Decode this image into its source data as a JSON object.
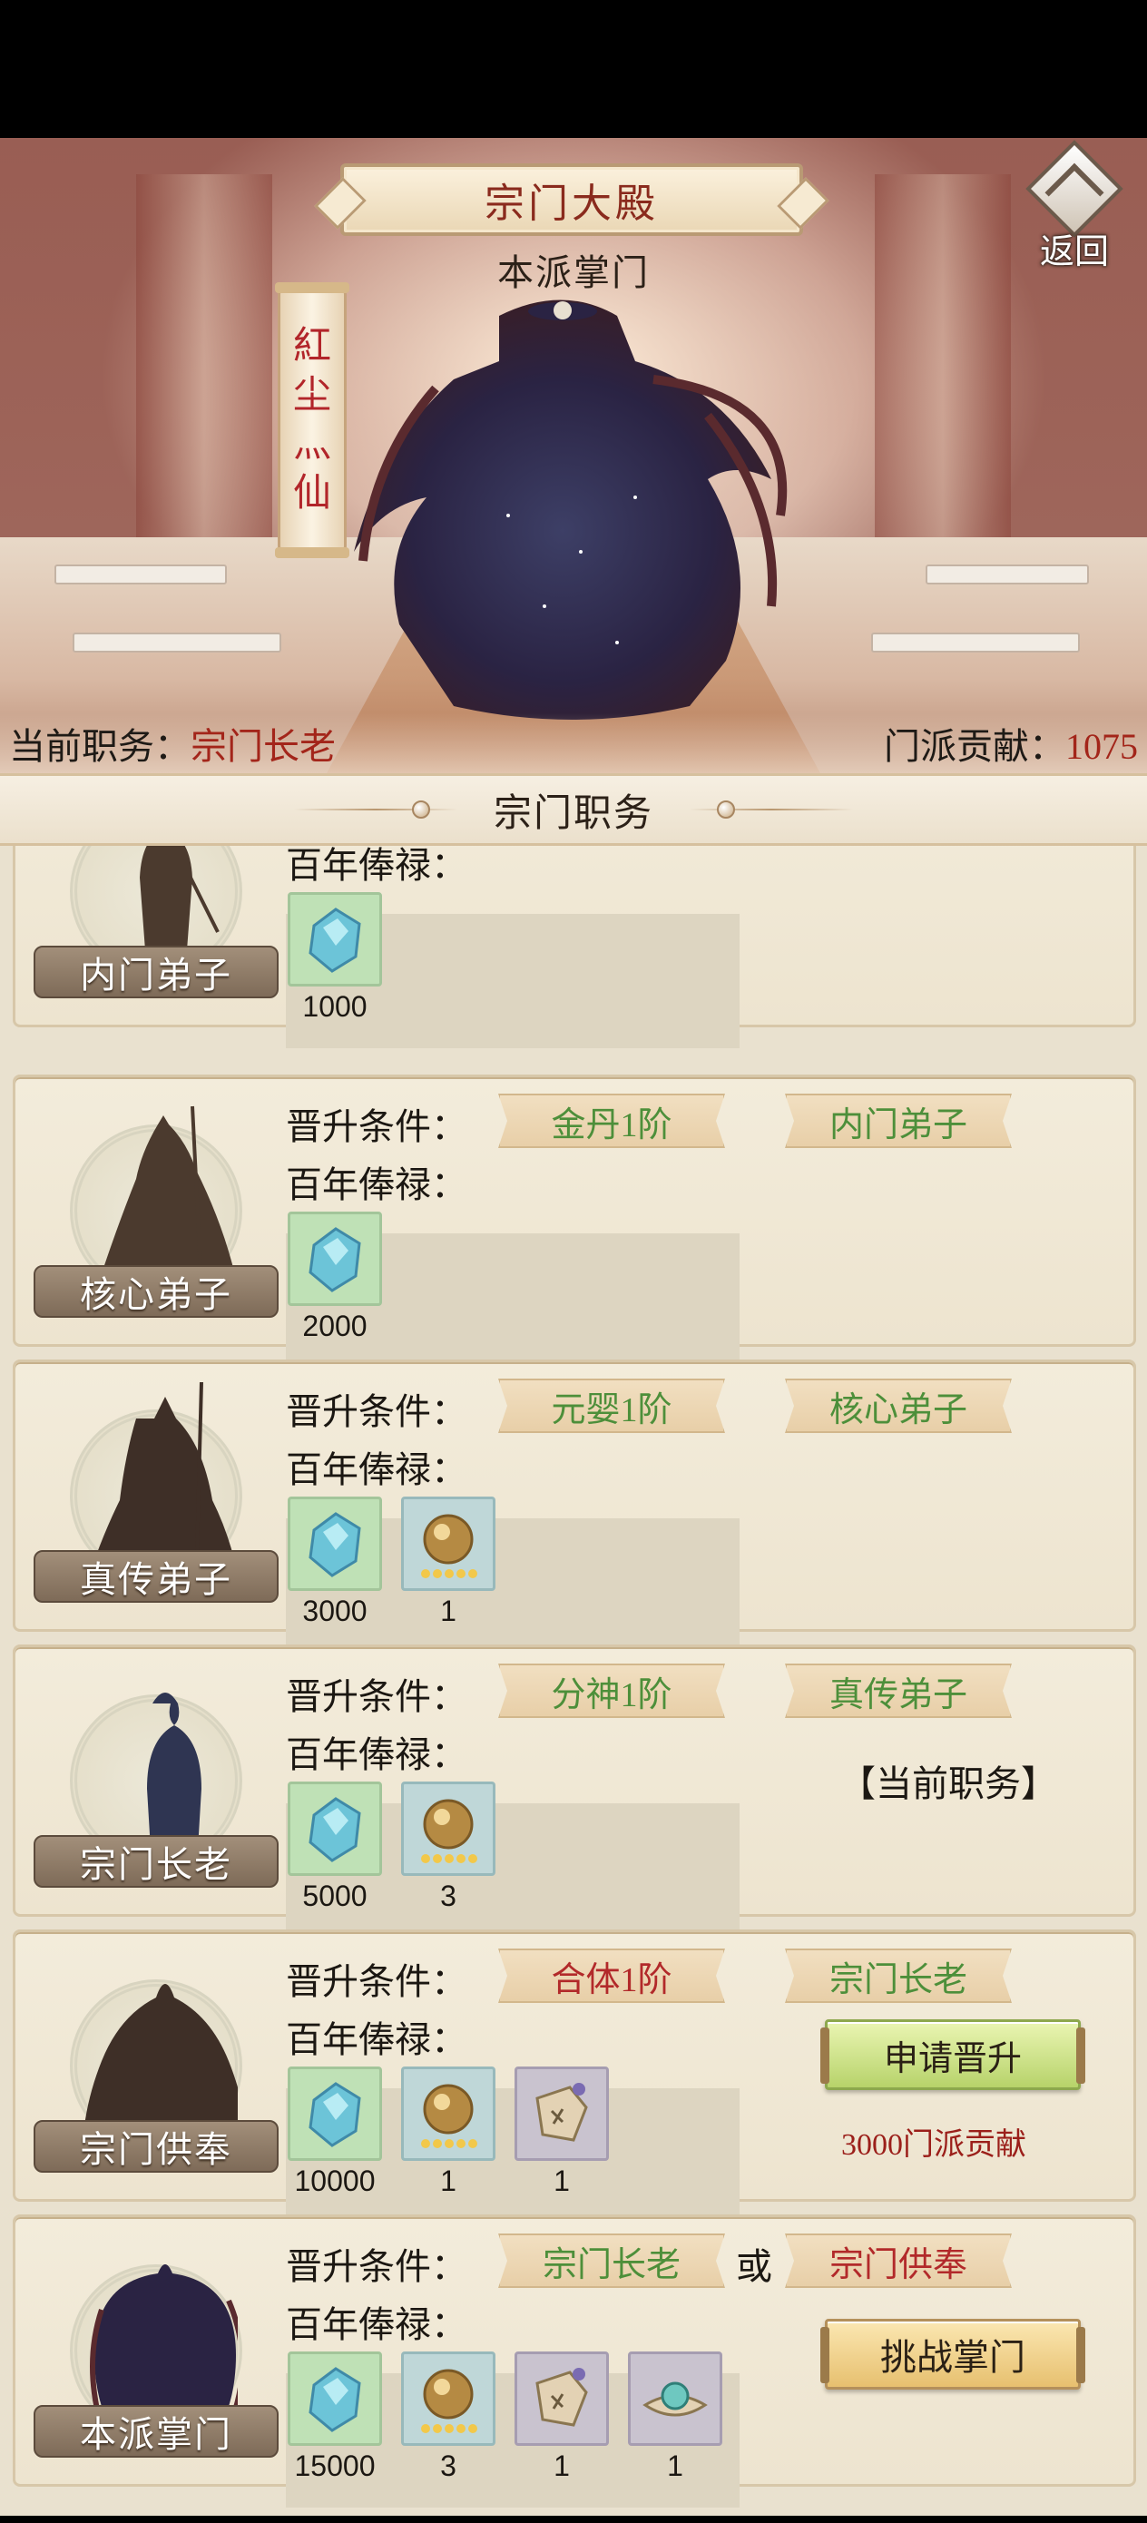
{
  "header": {
    "title": "宗门大殿",
    "leader_label": "本派掌门",
    "leader_name": [
      "紅",
      "尘",
      "灬",
      "仙"
    ],
    "back_label": "返回",
    "position_label": "当前职务：",
    "position_value": "宗门长老",
    "contribution_label": "门派贡献：",
    "contribution_value": "1075"
  },
  "section": {
    "title": "宗门职务"
  },
  "labels": {
    "promote_cond": "晋升条件：",
    "salary": "百年俸禄：",
    "or": "或"
  },
  "ranks": [
    {
      "name": "内门弟子",
      "conditions": [],
      "rewards": [
        {
          "type": "crystal",
          "qty": "1000"
        }
      ]
    },
    {
      "name": "核心弟子",
      "conditions": [
        {
          "text": "金丹1阶",
          "met": true
        },
        {
          "text": "内门弟子",
          "met": true
        }
      ],
      "rewards": [
        {
          "type": "crystal",
          "qty": "2000"
        }
      ]
    },
    {
      "name": "真传弟子",
      "conditions": [
        {
          "text": "元婴1阶",
          "met": true
        },
        {
          "text": "核心弟子",
          "met": true
        }
      ],
      "rewards": [
        {
          "type": "crystal",
          "qty": "3000"
        },
        {
          "type": "orb",
          "qty": "1"
        }
      ]
    },
    {
      "name": "宗门长老",
      "conditions": [
        {
          "text": "分神1阶",
          "met": true
        },
        {
          "text": "真传弟子",
          "met": true
        }
      ],
      "rewards": [
        {
          "type": "crystal",
          "qty": "5000"
        },
        {
          "type": "orb",
          "qty": "3"
        }
      ],
      "status": "【当前职务】"
    },
    {
      "name": "宗门供奉",
      "conditions": [
        {
          "text": "合体1阶",
          "met": false
        },
        {
          "text": "宗门长老",
          "met": true
        }
      ],
      "rewards": [
        {
          "type": "crystal",
          "qty": "10000"
        },
        {
          "type": "orb",
          "qty": "1"
        },
        {
          "type": "scroll",
          "qty": "1"
        }
      ],
      "action": "申请晋升",
      "cost": "3000门派贡献"
    },
    {
      "name": "本派掌门",
      "conditions": [
        {
          "text": "宗门长老",
          "met": true
        },
        {
          "text": "宗门供奉",
          "met": false
        }
      ],
      "rewards": [
        {
          "type": "crystal",
          "qty": "15000"
        },
        {
          "type": "orb",
          "qty": "3"
        },
        {
          "type": "scroll",
          "qty": "1"
        },
        {
          "type": "pearl",
          "qty": "1"
        }
      ],
      "action": "挑战掌门"
    }
  ],
  "colors": {
    "met": "#4d8f3a",
    "unmet": "#b2292a",
    "accent": "#a3251a"
  }
}
